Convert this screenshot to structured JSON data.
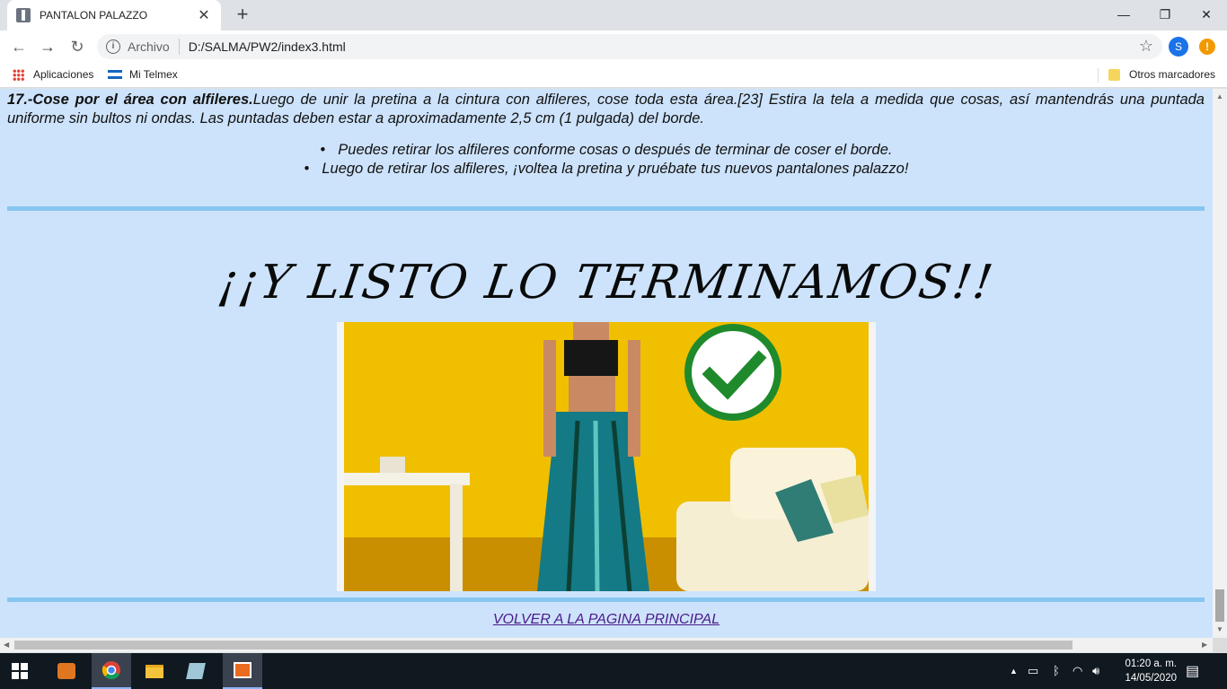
{
  "browser": {
    "tab_title": "PANTALON PALAZZO",
    "tab_close": "✕",
    "new_tab": "+",
    "minimize": "—",
    "maximize": "❐",
    "close": "✕",
    "back": "←",
    "forward": "→",
    "reload": "↻",
    "info_glyph": "i",
    "scheme_label": "Archivo",
    "url": "D:/SALMA/PW2/index3.html",
    "star": "☆",
    "profile_initial": "S",
    "alert_glyph": "!"
  },
  "bookmarks": {
    "apps_label": "Aplicaciones",
    "telmex_label": "Mi Telmex",
    "other_label": "Otros marcadores"
  },
  "page": {
    "step_bold": "17.-Cose por el área con alfileres.",
    "step_text": "Luego de unir la pretina a la cintura con alfileres, cose toda esta área.[23] Estira la tela a medida que cosas, así mantendrás una puntada uniforme sin bultos ni ondas. Las puntadas deben estar a aproximadamente 2,5 cm (1 pulgada) del borde.",
    "bullets": [
      "Puedes retirar los alfileres conforme cosas o después de terminar de coser el borde.",
      "Luego de retirar los alfileres, ¡voltea la pretina y pruébate tus nuevos pantalones palazzo!"
    ],
    "finale_heading": "¡¡Y LISTO LO TERMINAMOS!!",
    "back_link": "VOLVER A LA PAGINA PRINCIPAL"
  },
  "taskbar": {
    "time": "01:20 a. m.",
    "date": "14/05/2020"
  },
  "colors": {
    "page_bg": "#cde3fb",
    "rule": "#87c6f0",
    "link": "#4b1a8a",
    "check_green": "#1f8a2c"
  }
}
